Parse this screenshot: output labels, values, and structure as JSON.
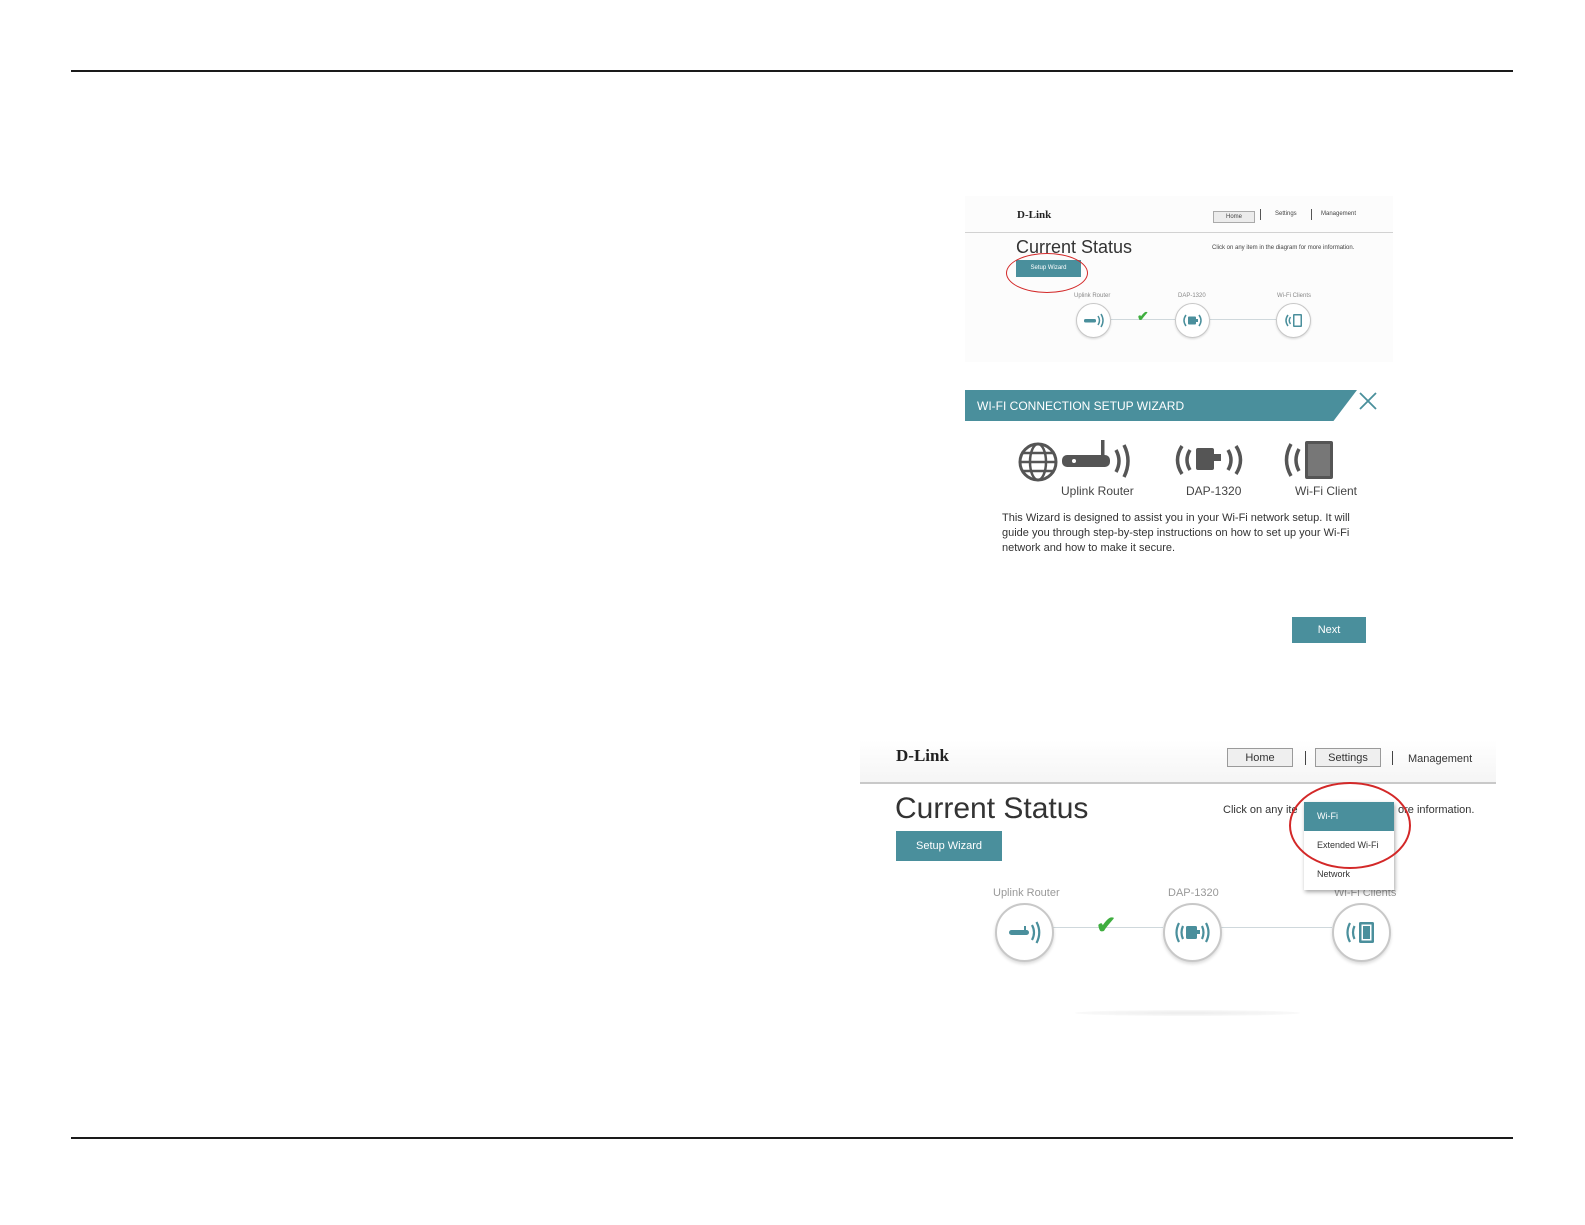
{
  "colors": {
    "accent": "#4a8f9c",
    "annotation": "#d32828",
    "check": "#3fae3f"
  },
  "shot1": {
    "logo": "D-Link",
    "nav": {
      "home": "Home",
      "settings": "Settings",
      "management": "Management"
    },
    "title": "Current Status",
    "hint": "Click on any item in the diagram for more information.",
    "setup_wizard": "Setup Wizard",
    "nodes": {
      "uplink": "Uplink Router",
      "device": "DAP-1320",
      "clients": "Wi-Fi Clients"
    }
  },
  "wizard": {
    "title": "WI-FI CONNECTION SETUP WIZARD",
    "labels": {
      "uplink": "Uplink Router",
      "device": "DAP-1320",
      "client": "Wi-Fi Client"
    },
    "text": "This Wizard is designed to assist you in your Wi-Fi network setup. It will guide you through step-by-step instructions on how to set up your Wi-Fi network and how to make it secure.",
    "next": "Next"
  },
  "shot3": {
    "logo": "D-Link",
    "nav": {
      "home": "Home",
      "settings": "Settings",
      "management": "Management"
    },
    "title": "Current Status",
    "hint_left": "Click on any ite",
    "hint_right": "ore information.",
    "setup_wizard": "Setup Wizard",
    "nodes": {
      "uplink": "Uplink Router",
      "device": "DAP-1320",
      "clients": "Wi-Fi Clients"
    },
    "dropdown": [
      "Wi-Fi",
      "Extended Wi-Fi",
      "Network"
    ]
  }
}
